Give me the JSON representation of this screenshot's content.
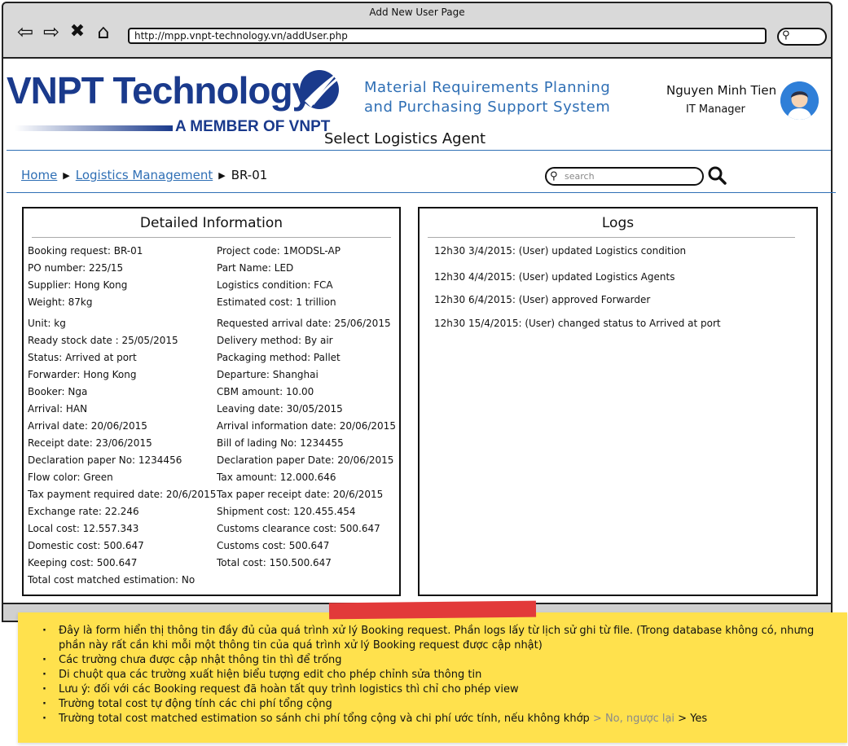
{
  "browser": {
    "title": "Add New User Page",
    "url": "http://mpp.vnpt-technology.vn/addUser.php"
  },
  "header": {
    "logo_main": "VNPT Technology",
    "logo_sub": "A MEMBER OF VNPT",
    "system_name": "Material Requirements Planning and Purchasing Support System",
    "user_name": "Nguyen Minh Tien",
    "user_role": "IT Manager",
    "page_title": "Select Logistics Agent"
  },
  "breadcrumb": {
    "home": "Home",
    "section": "Logistics Management",
    "current": "BR-01"
  },
  "search": {
    "placeholder": "search"
  },
  "detail": {
    "title": "Detailed Information",
    "left": [
      "Booking request: BR-01",
      "PO number: 225/15",
      "Supplier: Hong Kong",
      "Weight: 87kg",
      "Unit: kg",
      "Ready stock date : 25/05/2015",
      "Status:   Arrived at port",
      "Forwarder: Hong Kong",
      "Booker: Nga",
      "Arrival: HAN",
      "Arrival date: 20/06/2015",
      "Receipt date: 23/06/2015",
      "Declaration paper No: 1234456",
      "Flow color: Green",
      "Tax payment required date: 20/6/2015",
      "Exchange rate: 22.246",
      "Local cost: 12.557.343",
      "Domestic cost: 500.647",
      "Keeping cost: 500.647",
      "Total cost matched estimation: No"
    ],
    "right": [
      "Project code: 1MODSL-AP",
      "Part Name: LED",
      "Logistics condition: FCA",
      "Estimated cost: 1 trillion",
      "Requested arrival date: 25/06/2015",
      "Delivery method: By air",
      "Packaging method: Pallet",
      "Departure: Shanghai",
      "CBM amount: 10.00",
      "Leaving date: 30/05/2015",
      "Arrival information date: 20/06/2015",
      "Bill of lading No: 1234455",
      "Declaration paper Date: 20/06/2015",
      "Tax amount: 12.000.646",
      "Tax paper receipt date: 20/6/2015",
      "Shipment cost: 120.455.454",
      "Customs clearance cost: 500.647",
      "Customs cost: 500.647",
      "Total cost: 150.500.647"
    ]
  },
  "logs": {
    "title": "Logs",
    "entries": [
      "12h30 3/4/2015: (User) updated Logistics condition",
      "12h30 4/4/2015: (User) updated Logistics Agents",
      "12h30 6/4/2015: (User) approved Forwarder",
      "12h30 15/4/2015: (User) changed status to Arrived at port"
    ]
  },
  "note": {
    "items": [
      "Đây là form hiển thị thông tin đầy đủ của quá trình xử lý Booking request. Phần logs lấy từ lịch sử ghi từ file. (Trong database không có, nhưng phần này rất cần khi mỗi một thông tin của quá trình xử lý Booking request được cập nhật)",
      "Các trường chưa được cập nhật thông tin thì để trống",
      "Di chuột qua các trường xuất hiện biểu tượng edit cho phép chỉnh sửa thông tin",
      "Lưu ý: đối với các Booking request đã hoàn tất quy trình logistics thì chỉ cho phép view",
      "Trường total cost tự động tính các chi phí tổng cộng"
    ],
    "last_item": {
      "prefix": "Trường total cost matched estimation so sánh chi phí tổng cộng và chi phí ước tính, nếu không khớp",
      "muted": " > No, ngược lại",
      "suffix": " > Yes"
    }
  },
  "colors": {
    "brand_blue": "#1a3a8c",
    "link_blue": "#2f6fb5",
    "note_yellow": "#ffe14d",
    "tape_red": "#e23a3a"
  }
}
